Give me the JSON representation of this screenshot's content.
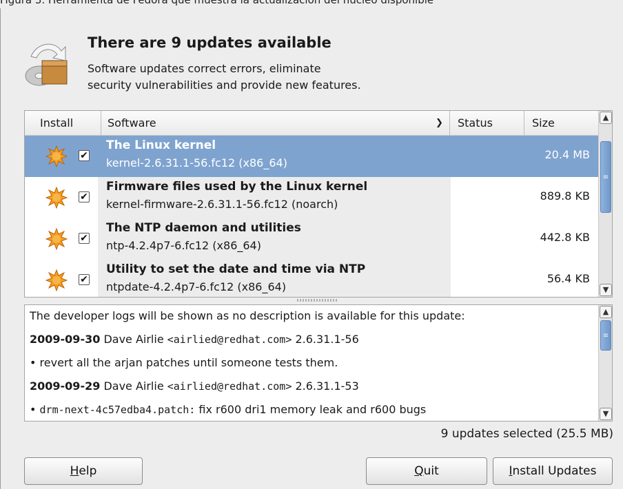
{
  "caption": "Figura 3. Herramienta de Fedora que muestra la actualización del núcleo disponible",
  "header": {
    "title": "There are 9 updates available",
    "subtitle_line1": "Software updates correct errors, eliminate",
    "subtitle_line2": "security vulnerabilities and provide new features.",
    "icon": "software-update-box-icon"
  },
  "list": {
    "columns": {
      "install": "Install",
      "software": "Software",
      "status": "Status",
      "size": "Size"
    },
    "rows": [
      {
        "name": "The Linux kernel",
        "version": "kernel-2.6.31.1-56.fc12 (x86_64)",
        "size": "20.4 MB",
        "checked": "✔",
        "selected": true
      },
      {
        "name": "Firmware files used by the Linux kernel",
        "version": "kernel-firmware-2.6.31.1-56.fc12 (noarch)",
        "size": "889.8 KB",
        "checked": "✔",
        "selected": false
      },
      {
        "name": "The NTP daemon and utilities",
        "version": "ntp-4.2.4p7-6.fc12 (x86_64)",
        "size": "442.8 KB",
        "checked": "✔",
        "selected": false
      },
      {
        "name": "Utility to set the date and time via NTP",
        "version": "ntpdate-4.2.4p7-6.fc12 (x86_64)",
        "size": "56.4 KB",
        "checked": "✔",
        "selected": false
      }
    ]
  },
  "description": {
    "intro": "The developer logs will be shown as no description is available for this update:",
    "entries": [
      {
        "date": "2009-09-30",
        "author": "Dave Airlie ",
        "email": "<airlied@redhat.com>",
        "version": " 2.6.31.1-56"
      },
      {
        "bullet": "• revert all the arjan patches until someone tests them."
      },
      {
        "date": "2009-09-29",
        "author": "Dave Airlie ",
        "email": "<airlied@redhat.com>",
        "version": " 2.6.31.1-53"
      },
      {
        "bullet_prefix": "• ",
        "bullet_code": "drm-next-4c57edba4.patch:",
        "bullet_rest": " fix r600 dri1 memory leak and r600 bugs"
      }
    ]
  },
  "summary": "9 updates selected (25.5 MB)",
  "buttons": {
    "help_u": "H",
    "help_rest": "elp",
    "quit_u": "Q",
    "quit_rest": "uit",
    "install_u": "I",
    "install_rest": "nstall Updates"
  },
  "colors": {
    "selection": "#7fa3cf",
    "update_icon": "#f39c1e"
  }
}
